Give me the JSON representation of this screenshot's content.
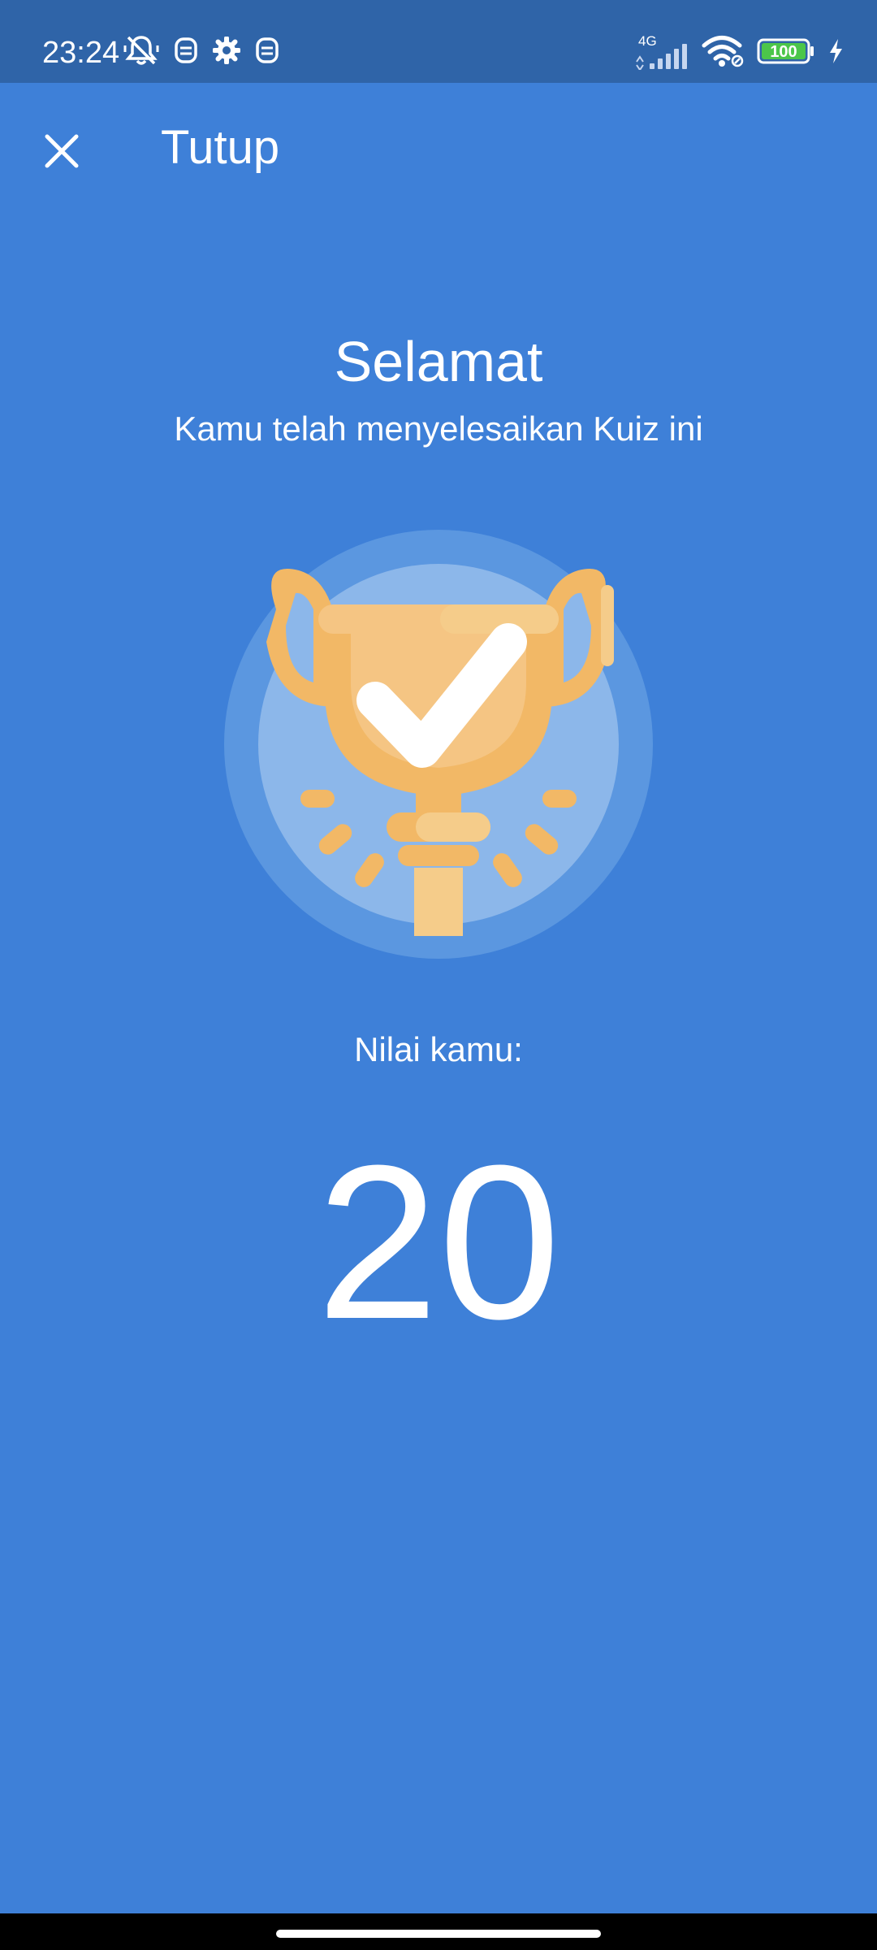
{
  "status_bar": {
    "time": "23:24",
    "network": "4G",
    "battery": "100",
    "icons_left": [
      "bell-off-icon",
      "app-notification-icon",
      "gear-icon",
      "app-notification-icon"
    ],
    "icons_right": [
      "signal-icon",
      "wifi-icon",
      "battery-icon",
      "charging-icon"
    ]
  },
  "header": {
    "close_label": "Tutup",
    "close_icon": "close-icon"
  },
  "main": {
    "title": "Selamat",
    "subtitle": "Kamu telah menyelesaikan Kuiz ini",
    "illustration": "trophy-check-icon",
    "score_label": "Nilai kamu:",
    "score_value": "20"
  },
  "colors": {
    "background": "#3e80d8",
    "status_bar": "#2f64a8",
    "trophy": "#f2b866",
    "trophy_light": "#f5cc8a",
    "circle_outer": "#5b97e0",
    "circle_inner": "#8cb7ea"
  }
}
